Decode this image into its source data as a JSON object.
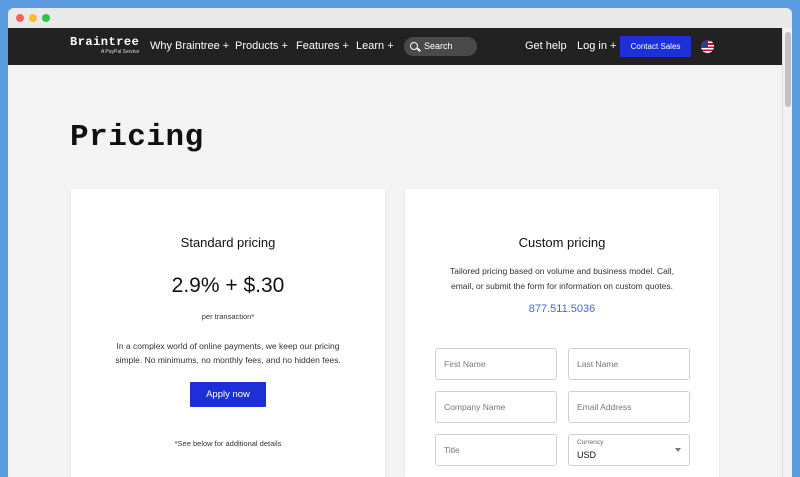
{
  "brand": {
    "name": "Braintree",
    "sub": "A PayPal Service"
  },
  "nav": {
    "items": [
      "Why Braintree +",
      "Products +",
      "Features +",
      "Learn +"
    ],
    "search_label": "Search",
    "get_help": "Get help",
    "login": "Log in +",
    "contact": "Contact Sales"
  },
  "page": {
    "title": "Pricing"
  },
  "standard": {
    "title": "Standard pricing",
    "price": "2.9% + $.30",
    "per": "per transaction*",
    "desc_line1": "In a complex world of online payments, we keep our pricing",
    "desc_line2": "simple. No minimums, no monthly fees, and no hidden fees.",
    "apply": "Apply now",
    "footnote": "*See below for additional details"
  },
  "custom": {
    "title": "Custom pricing",
    "desc_line1": "Tailored pricing based on volume and business model. Call,",
    "desc_line2": "email, or submit the form for information on custom quotes.",
    "phone": "877.511.5036",
    "form": {
      "first_name": "First Name",
      "last_name": "Last Name",
      "company": "Company Name",
      "email": "Email Address",
      "title": "Title",
      "currency_label": "Currency",
      "currency_value": "USD"
    }
  },
  "colors": {
    "nav_bg": "#222222",
    "accent": "#1d2fd6",
    "link": "#4a67d6",
    "page_bg": "#f3f3f3"
  },
  "icons": {
    "search": "search-icon",
    "flag": "us-flag-icon",
    "currency_dropdown": "chevron-down-icon"
  }
}
